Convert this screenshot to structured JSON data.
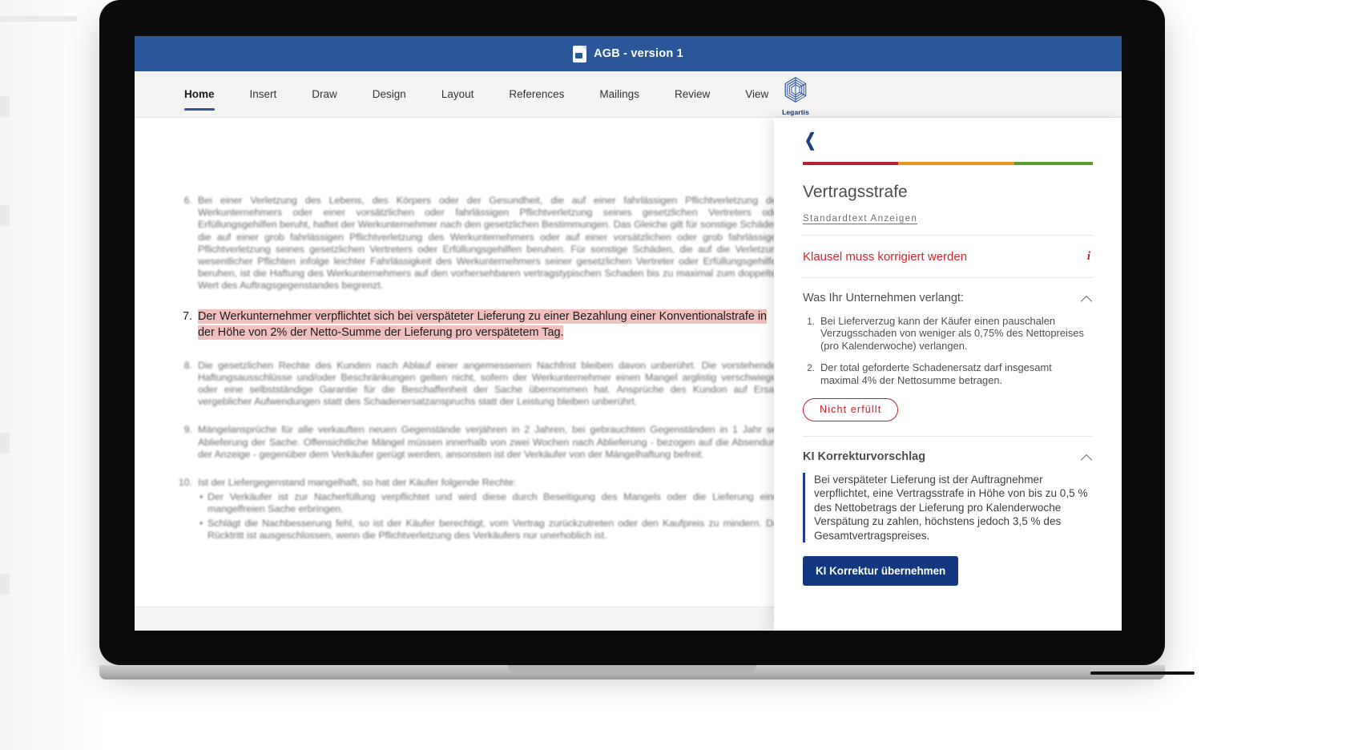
{
  "window": {
    "title": "AGB - version 1",
    "doc_icon": "word-document-icon"
  },
  "ribbon": {
    "tabs": [
      {
        "label": "Home",
        "active": true
      },
      {
        "label": "Insert",
        "active": false
      },
      {
        "label": "Draw",
        "active": false
      },
      {
        "label": "Design",
        "active": false
      },
      {
        "label": "Layout",
        "active": false
      },
      {
        "label": "References",
        "active": false
      },
      {
        "label": "Mailings",
        "active": false
      },
      {
        "label": "Review",
        "active": false
      },
      {
        "label": "View",
        "active": false
      }
    ],
    "addin": {
      "name": "Legartis",
      "icon": "legartis-hexagon-logo"
    }
  },
  "document": {
    "clauses": [
      {
        "num": "6.",
        "text": "Bei einer Verletzung des Lebens, des Körpers oder der Gesundheit, die auf einer fahrlässigen Pflichtverletzung des Werkunternehmers oder einer vorsätzlichen oder fahrlässigen Pflichtverletzung seines gesetzlichen Vertreters oder Erfüllungsgehilfen beruht, haftet der Werkunternehmer nach den gesetzlichen Bestimmungen. Das Gleiche gilt für sonstige Schäden, die auf einer grob fahrlässigen Pflichtverletzung des Werkunternehmers oder auf einer vorsätzlichen oder grob fahrlässigen Pflichtverletzung seines gesetzlichen Vertreters oder Erfüllungsgehilfen beruhen. Für sonstige Schäden, die auf die Verletzung wesentlicher Pflichten infolge leichter Fahrlässigkeit des Werkunternehmers seiner gesetzlichen Vertreter oder Erfüllungsgehilfen beruhen, ist die Haftung des Werkunternehmers auf den vorhersehbaren vertragstypischen Schaden bis zu maximal zum doppelten Wert des Auftragsgegenstandes begrenzt.",
        "highlighted": false
      },
      {
        "num": "7.",
        "text": "Der Werkunternehmer verpflichtet sich bei verspäteter Lieferung zu einer Bezahlung einer Konventionalstrafe  in der Höhe von 2% der Netto-Summe der Lieferung pro verspätetem Tag.",
        "highlighted": true
      },
      {
        "num": "8.",
        "text": "Die gesetzlichen Rechte des Kunden nach Ablauf einer angemessenen Nachfrist bleiben davon unberührt. Die vorstehenden Haftungsausschlüsse und/oder Beschränkungen gelten nicht, sofern der Werkunternehmer einen Mangel arglistig verschwiegen oder eine selbstständige Garantie für die Beschaffenheit der Sache übernommen hat. Ansprüche des Kundon auf Ersatz vergeblicher Aufwendungen statt des Schadenersatzanspruchs statt der Leistung bleiben unberührt.",
        "highlighted": false
      },
      {
        "num": "9.",
        "text": "Mängelansprüche für alle verkauften neuen Gegenstände verjähren in 2 Jahren, bei gebrauchten Gegenständen in 1 Jahr seit Ablieferung der Sache. Offensichtliche Mängel müssen innerhalb von zwei Wochen nach Ablieferung - bezogen auf die Absendung der Anzeige - gegenüber dem Verkäufer gerügt werden, ansonsten ist der Verkäufer von der Mängelhaftung befreit.",
        "highlighted": false
      },
      {
        "num": "10.",
        "text": "Ist der Liefergegenstand mangelhaft, so hat der Käufer folgende Rechte:",
        "highlighted": false,
        "bullets": [
          "Der Verkäufer ist zur Nacherfüllung verpflichtet und wird diese durch Beseitigung des Mangels oder die Lieferung einer mangelfreien Sache erbringen.",
          "Schlägt die Nachbesserung fehl, so ist der Käufer berechtigt, vom Vertrag zurückzutreten oder den Kaufpreis zu mindern. Der Rücktritt ist ausgeschlossen, wenn die Pflichtverletzung des Verkäufers nur unerhoblich ist."
        ]
      }
    ]
  },
  "panel": {
    "back_icon": "chevron-left-icon",
    "risk_bar": {
      "segments": [
        {
          "name": "high-risk",
          "color": "#b5202c"
        },
        {
          "name": "medium-risk",
          "color": "#e8941d"
        },
        {
          "name": "low-risk",
          "color": "#5a9c2e"
        }
      ]
    },
    "title": "Vertragsstrafe",
    "standard_text_link": "Standardtext Anzeigen",
    "status": {
      "text": "Klausel muss korrigiert werden",
      "color": "#d2242f",
      "info_icon": "info-icon"
    },
    "requirements": {
      "heading": "Was Ihr Unternehmen verlangt:",
      "collapse_icon": "chevron-up-icon",
      "items": [
        "Bei Lieferverzug kann der Käufer einen pauschalen Verzugsschaden von weniger als 0,75% des Nettopreises (pro Kalenderwoche) verlangen.",
        "Der total geforderte Schadenersatz darf insgesamt maximal 4% der Nettosumme betragen."
      ],
      "badge": "Nicht erfüllt"
    },
    "ai_suggestion": {
      "heading": "KI Korrekturvorschlag",
      "collapse_icon": "chevron-up-icon",
      "text": "Bei verspäteter Lieferung ist der Auftragnehmer verpflichtet, eine Vertragsstrafe in Höhe von bis zu 0,5 % des Nettobetrags der Lieferung pro Kalenderwoche Verspätung zu zahlen, höchstens jedoch 3,5 % des Gesamtvertragspreises.",
      "apply_button": "KI Korrektur übernehmen"
    }
  },
  "colors": {
    "word_blue": "#2b579a",
    "legartis_navy": "#14387f",
    "risk_red": "#b5202c",
    "highlight_pink": "#f0c0bd"
  }
}
